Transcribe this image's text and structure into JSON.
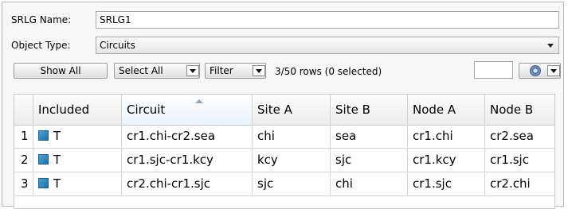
{
  "form": {
    "name_label": "SRLG Name:",
    "name_value": "SRLG1",
    "type_label": "Object Type:",
    "type_value": "Circuits"
  },
  "toolbar": {
    "show_all": "Show All",
    "select_all": "Select All",
    "filter": "Filter",
    "status": "3/50 rows (0 selected)",
    "page_field_value": ""
  },
  "table": {
    "columns": [
      "Included",
      "Circuit",
      "Site A",
      "Site B",
      "Node A",
      "Node B"
    ],
    "sorted_column": "Circuit",
    "rows": [
      {
        "num": "1",
        "included": "T",
        "circuit": "cr1.chi-cr2.sea",
        "site_a": "chi",
        "site_b": "sea",
        "node_a": "cr1.chi",
        "node_b": "cr2.sea"
      },
      {
        "num": "2",
        "included": "T",
        "circuit": "cr1.sjc-cr1.kcy",
        "site_a": "kcy",
        "site_b": "sjc",
        "node_a": "cr1.kcy",
        "node_b": "cr1.sjc"
      },
      {
        "num": "3",
        "included": "T",
        "circuit": "cr2.chi-cr1.sjc",
        "site_a": "sjc",
        "site_b": "chi",
        "node_a": "cr1.sjc",
        "node_b": "cr2.chi"
      }
    ]
  },
  "icons": {
    "settings": "gear-icon",
    "included_marker": "included-swatch-icon"
  }
}
